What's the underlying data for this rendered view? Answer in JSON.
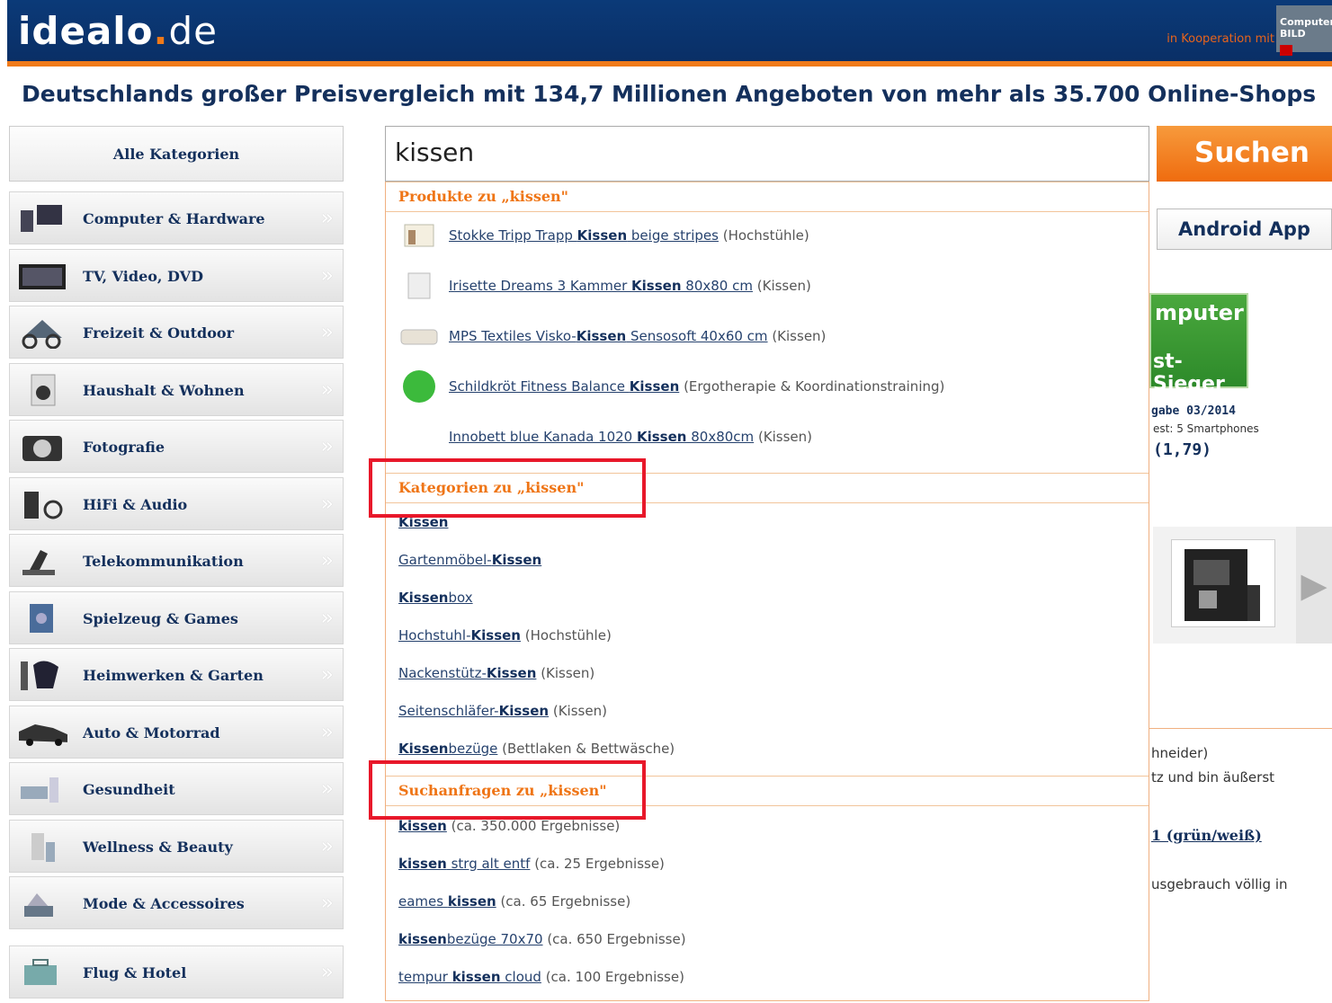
{
  "header": {
    "logo_main": "idealo",
    "logo_dot": ".",
    "logo_tld": "de",
    "cooperation": "in Kooperation mit",
    "partner_badge": "Computer BILD"
  },
  "headline": "Deutschlands großer Preisvergleich mit 134,7 Millionen Angeboten von mehr als 35.700 Online-Shops",
  "sidebar": {
    "all_label": "Alle Kategorien",
    "items": [
      {
        "label": "Computer & Hardware",
        "icon": "computer-icon"
      },
      {
        "label": "TV, Video, DVD",
        "icon": "tv-icon"
      },
      {
        "label": "Freizeit & Outdoor",
        "icon": "bicycle-icon"
      },
      {
        "label": "Haushalt & Wohnen",
        "icon": "washing-machine-icon"
      },
      {
        "label": "Fotografie",
        "icon": "camera-icon"
      },
      {
        "label": "HiFi & Audio",
        "icon": "speaker-icon"
      },
      {
        "label": "Telekommunikation",
        "icon": "phone-icon"
      },
      {
        "label": "Spielzeug & Games",
        "icon": "game-icon"
      },
      {
        "label": "Heimwerken & Garten",
        "icon": "tools-icon"
      },
      {
        "label": "Auto & Motorrad",
        "icon": "car-icon"
      },
      {
        "label": "Gesundheit",
        "icon": "health-icon"
      },
      {
        "label": "Wellness & Beauty",
        "icon": "wellness-icon"
      },
      {
        "label": "Mode & Accessoires",
        "icon": "fashion-icon"
      },
      {
        "label": "Flug & Hotel",
        "icon": "suitcase-icon"
      }
    ],
    "arrow": "»"
  },
  "search": {
    "value": "kissen",
    "button": "Suchen"
  },
  "right": {
    "android": "Android App",
    "seal_top": "mputer",
    "seal_bottom": "st-Sieger",
    "issue": "gabe 03/2014",
    "test": "est: 5 Smartphones",
    "grade": "(1,79)",
    "next_arrow": "▶",
    "snippet1": "hneider)",
    "snippet2": "tz und bin äußerst",
    "snippet3": "1 (grün/weiß)",
    "snippet4": "usgebrauch völlig in"
  },
  "dropdown": {
    "products_head": "Produkte zu „kissen\"",
    "products": [
      {
        "pre": "Stokke Tripp Trapp ",
        "kw": "Kissen",
        "post": " beige stripes",
        "cat": "(Hochstühle)"
      },
      {
        "pre": "Irisette Dreams 3 Kammer ",
        "kw": "Kissen",
        "post": " 80x80 cm",
        "cat": "(Kissen)"
      },
      {
        "pre": "MPS Textiles Visko-",
        "kw": "Kissen",
        "post": " Sensosoft 40x60 cm",
        "cat": "(Kissen)"
      },
      {
        "pre": "Schildkröt Fitness Balance ",
        "kw": "Kissen",
        "post": "",
        "cat": "(Ergotherapie & Koordinationstraining)"
      },
      {
        "pre": "Innobett blue Kanada 1020 ",
        "kw": "Kissen",
        "post": " 80x80cm",
        "cat": "(Kissen)"
      }
    ],
    "categories_head": "Kategorien zu „kissen\"",
    "categories": [
      {
        "pre": "",
        "kw": "Kissen",
        "post": "",
        "extra": ""
      },
      {
        "pre": "Gartenmöbel-",
        "kw": "Kissen",
        "post": "",
        "extra": ""
      },
      {
        "pre": "",
        "kw": "Kissen",
        "post": "box",
        "extra": ""
      },
      {
        "pre": "Hochstuhl-",
        "kw": "Kissen",
        "post": "",
        "extra": "(Hochstühle)"
      },
      {
        "pre": "Nackenstütz-",
        "kw": "Kissen",
        "post": "",
        "extra": "(Kissen)"
      },
      {
        "pre": "Seitenschläfer-",
        "kw": "Kissen",
        "post": "",
        "extra": "(Kissen)"
      },
      {
        "pre": "",
        "kw": "Kissen",
        "post": "bezüge",
        "extra": "(Bettlaken & Bettwäsche)"
      }
    ],
    "queries_head": "Suchanfragen zu „kissen\"",
    "queries": [
      {
        "pre": "",
        "kw": "kissen",
        "post": "",
        "extra": "(ca. 350.000 Ergebnisse)"
      },
      {
        "pre": "",
        "kw": "kissen",
        "post": " strg alt entf",
        "extra": "(ca. 25 Ergebnisse)"
      },
      {
        "pre": "eames ",
        "kw": "kissen",
        "post": "",
        "extra": "(ca. 65 Ergebnisse)"
      },
      {
        "pre": "",
        "kw": "kissen",
        "post": "bezüge 70x70",
        "extra": "(ca. 650 Ergebnisse)"
      },
      {
        "pre": "tempur ",
        "kw": "kissen",
        "post": " cloud",
        "extra": "(ca. 100 Ergebnisse)"
      }
    ]
  },
  "colors": {
    "brand_blue": "#0b3a78",
    "brand_orange": "#f07a19",
    "highlight_red": "#e8182a"
  }
}
